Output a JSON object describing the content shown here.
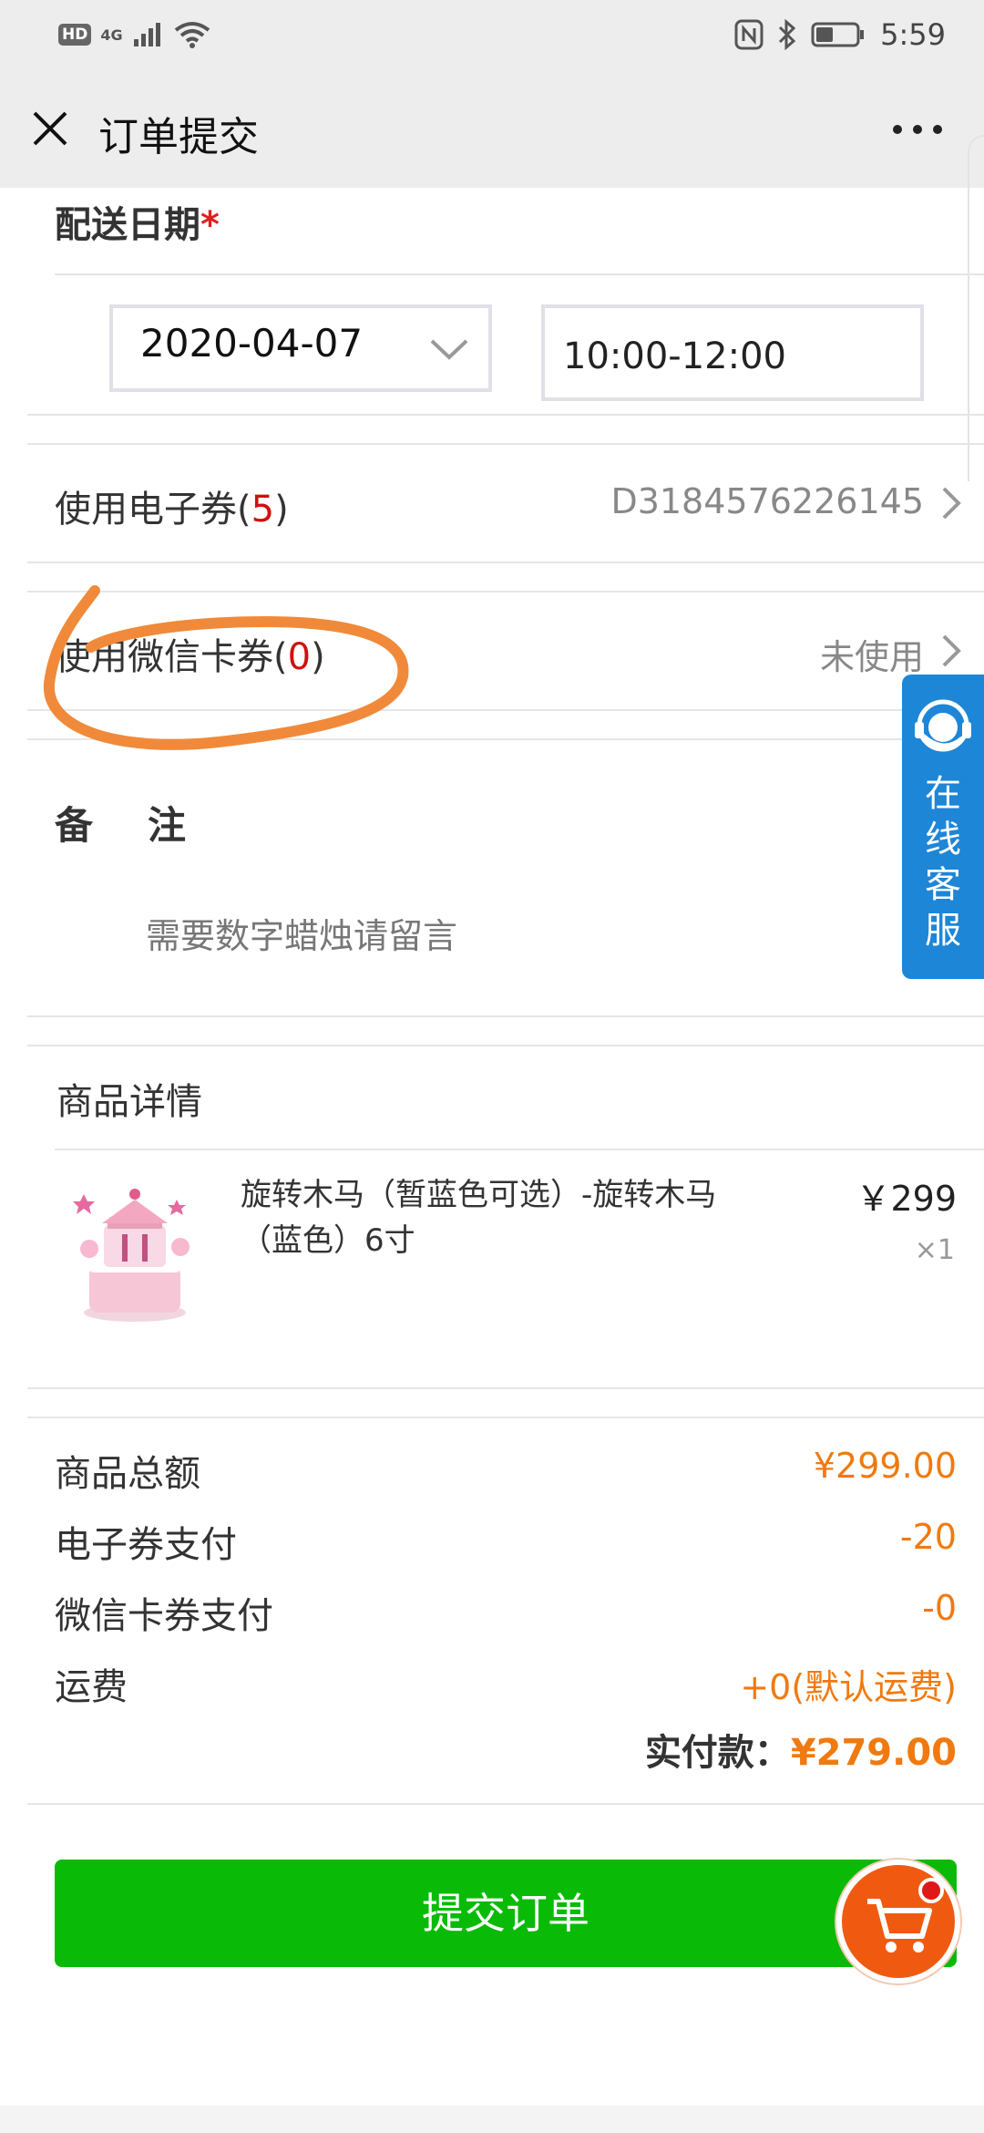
{
  "status_bar": {
    "hd": "HD",
    "network": "4G",
    "time": "5:59",
    "icons": [
      "signal-icon",
      "wifi-icon",
      "nfc-icon",
      "bluetooth-icon",
      "battery-icon"
    ]
  },
  "nav": {
    "title": "订单提交",
    "close_icon": "close-icon",
    "more_icon": "more-icon"
  },
  "delivery": {
    "title": "配送日期",
    "required_mark": "*",
    "date_value": "2020-04-07",
    "time_value": "10:00-12:00"
  },
  "ecoupon": {
    "label": "使用电子券",
    "paren_open": "(",
    "count": "5",
    "paren_close": ")",
    "value": "D3184576226145"
  },
  "wechat_coupon": {
    "label": "使用微信卡券",
    "paren_open": "(",
    "count": "0",
    "paren_close": ")",
    "value": "未使用"
  },
  "remark": {
    "title": "备注",
    "placeholder": "需要数字蜡烛请留言"
  },
  "service": {
    "label_lines": [
      "在",
      "线",
      "客",
      "服"
    ]
  },
  "product": {
    "section_title": "商品详情",
    "name": "旋转木马（暂蓝色可选）-旋转木马（蓝色）6寸",
    "price": "￥299",
    "qty": "×1"
  },
  "summary": {
    "rows": [
      {
        "label": "商品总额",
        "value": "¥299.00"
      },
      {
        "label": "电子券支付",
        "value": "-20"
      },
      {
        "label": "微信卡券支付",
        "value": "-0"
      },
      {
        "label": "运费",
        "value": "+0(默认运费)"
      }
    ],
    "total_label": "实付款：",
    "total_value": "¥279.00"
  },
  "actions": {
    "submit_label": "提交订单",
    "cart_icon": "cart-icon"
  },
  "colors": {
    "accent_orange": "#f07a10",
    "submit_green": "#09bb07",
    "service_blue": "#1e86d6",
    "required_red": "#e02020",
    "annotation_orange": "#f08a3a"
  }
}
